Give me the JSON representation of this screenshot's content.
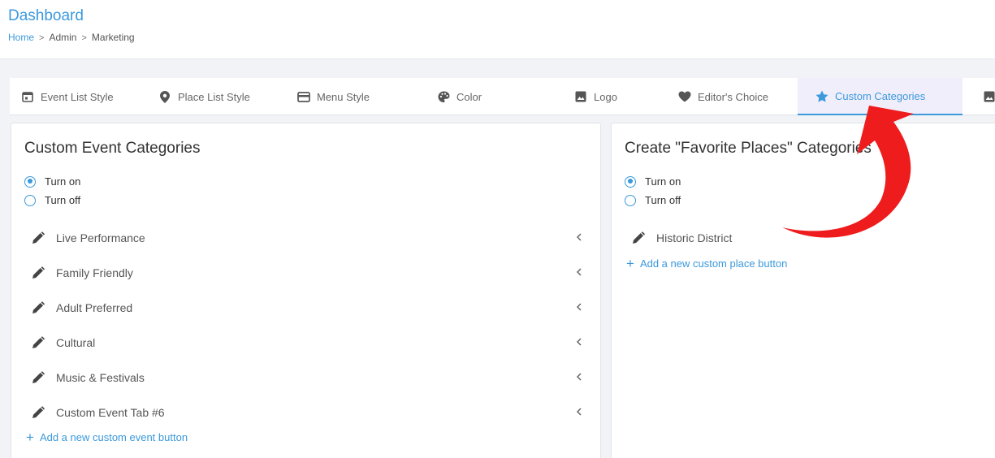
{
  "header": {
    "title": "Dashboard",
    "breadcrumb": [
      "Home",
      "Admin",
      "Marketing"
    ]
  },
  "tabs": [
    {
      "label": "Event List Style",
      "icon": "calendar-icon"
    },
    {
      "label": "Place List Style",
      "icon": "map-pin-icon"
    },
    {
      "label": "Menu Style",
      "icon": "card-icon"
    },
    {
      "label": "Color",
      "icon": "palette-icon"
    },
    {
      "label": "Logo",
      "icon": "image-icon"
    },
    {
      "label": "Editor's Choice",
      "icon": "heart-icon"
    },
    {
      "label": "Custom Categories",
      "icon": "star-icon",
      "active": true
    },
    {
      "label": "",
      "icon": "image-icon"
    }
  ],
  "left_panel": {
    "title": "Custom Event Categories",
    "radio_on": "Turn on",
    "radio_off": "Turn off",
    "selected": "on",
    "categories": [
      "Live Performance",
      "Family Friendly",
      "Adult Preferred",
      "Cultural",
      "Music & Festivals",
      "Custom Event Tab #6"
    ],
    "add_label": "Add a new custom event button"
  },
  "right_panel": {
    "title": "Create \"Favorite Places\" Categories",
    "radio_on": "Turn on",
    "radio_off": "Turn off",
    "selected": "on",
    "categories": [
      "Historic District"
    ],
    "add_label": "Add a new custom place button"
  },
  "colors": {
    "accent": "#3b99dc",
    "arrow": "#ee1c1c",
    "active_tab_bg": "#f1eefb"
  }
}
